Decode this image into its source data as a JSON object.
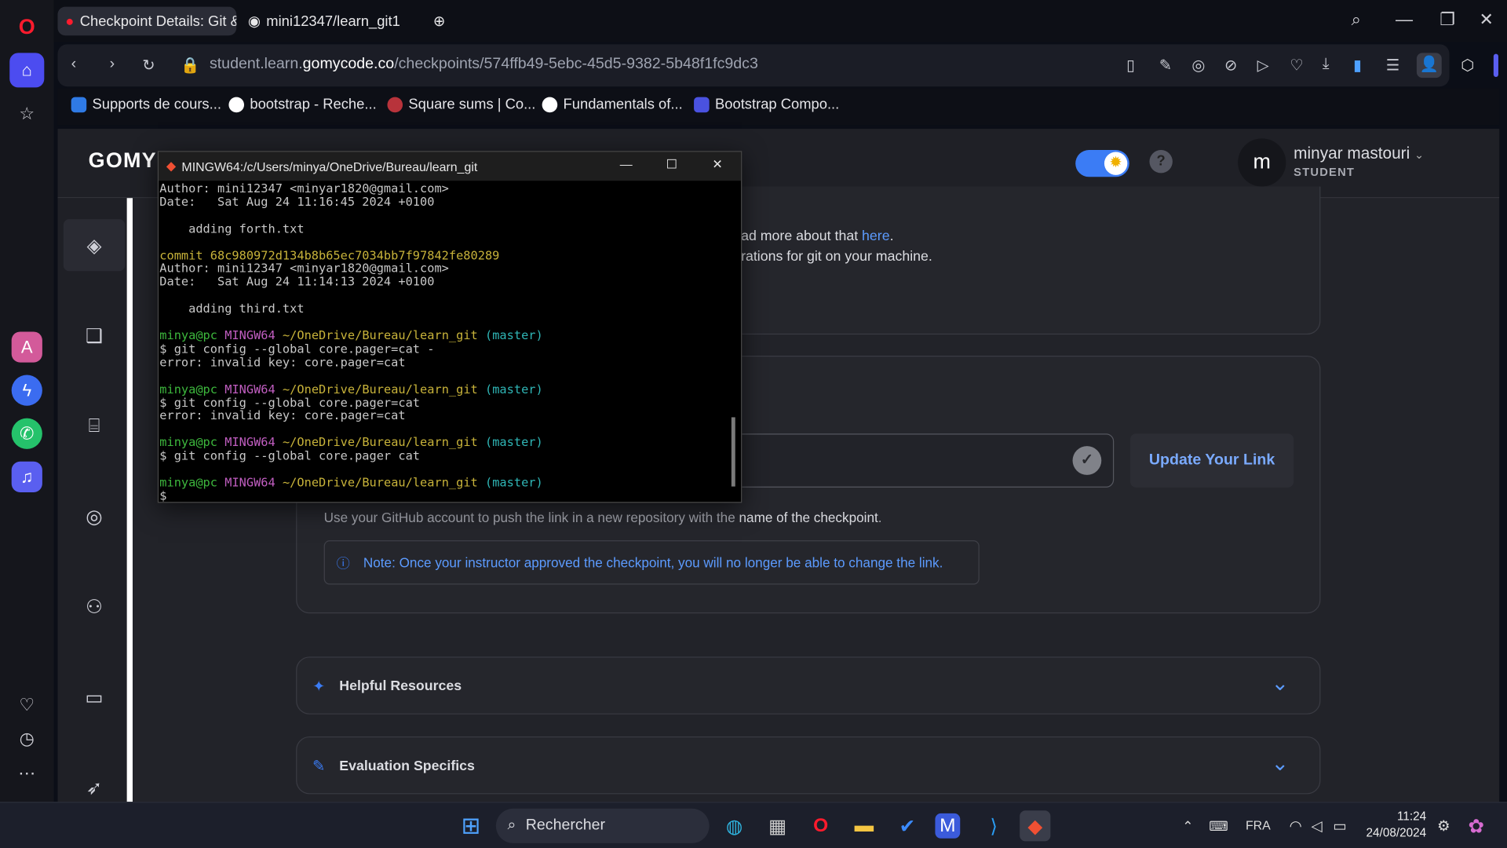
{
  "browser": {
    "tabs": [
      {
        "label": "Checkpoint Details: Git &"
      },
      {
        "label": "mini12347/learn_git1"
      }
    ],
    "url_prefix": "student.learn.",
    "url_domain": "gomycode.co",
    "url_path": "/checkpoints/574ffb49-5ebc-45d5-9382-5b48f1fc9dc3",
    "bookmarks": [
      {
        "label": "Supports de cours..."
      },
      {
        "label": "bootstrap - Reche..."
      },
      {
        "label": "Square sums | Co..."
      },
      {
        "label": "Fundamentals of..."
      },
      {
        "label": "Bootstrap Compo..."
      }
    ]
  },
  "site": {
    "logo": "GOMY",
    "user_initial": "m",
    "user_name": "minyar mastouri",
    "user_role": "STUDENT",
    "help": "?"
  },
  "content": {
    "line1_pre": "ad more about that ",
    "line1_link": "here",
    "line1_post": ".",
    "line2": "rations for git on your machine.",
    "update_button": "Update Your Link",
    "hint": "Use your GitHub account to push the link in a new repository with the ",
    "hint_bold": "name of the checkpoint",
    "hint_end": ".",
    "note": "Note: Once your instructor approved the checkpoint, you will no longer be able to change the link.",
    "helpful_resources": "Helpful Resources",
    "evaluation_specifics": "Evaluation Specifics"
  },
  "terminal": {
    "title": "MINGW64:/c/Users/minya/OneDrive/Bureau/learn_git",
    "prompt_user": "minya@pc",
    "prompt_env": "MINGW64",
    "prompt_path": "~/OneDrive/Bureau/learn_git",
    "prompt_branch": "(master)",
    "l_author1": "Author: mini12347 <minyar1820@gmail.com>",
    "l_date1": "Date:   Sat Aug 24 11:16:45 2024 +0100",
    "l_msg1": "    adding forth.txt",
    "l_commit2": "commit 68c980972d134b8b65ec7034bb7f97842fe80289",
    "l_author2": "Author: mini12347 <minyar1820@gmail.com>",
    "l_date2": "Date:   Sat Aug 24 11:14:13 2024 +0100",
    "l_msg2": "    adding third.txt",
    "cmd1": "$ git config --global core.pager=cat -",
    "err1": "error: invalid key: core.pager=cat",
    "cmd2": "$ git config --global core.pager=cat",
    "err2": "error: invalid key: core.pager=cat",
    "cmd3": "$ git config --global core.pager cat",
    "cursor": "$"
  },
  "taskbar": {
    "search": "Rechercher",
    "lang": "FRA",
    "time": "11:24",
    "date": "24/08/2024"
  },
  "colors": {
    "accent": "#3b7cf5",
    "terminal_green": "#3db83d",
    "terminal_magenta": "#c15ec1",
    "terminal_yellow": "#c8b33a",
    "terminal_cyan": "#2fb6b6"
  }
}
